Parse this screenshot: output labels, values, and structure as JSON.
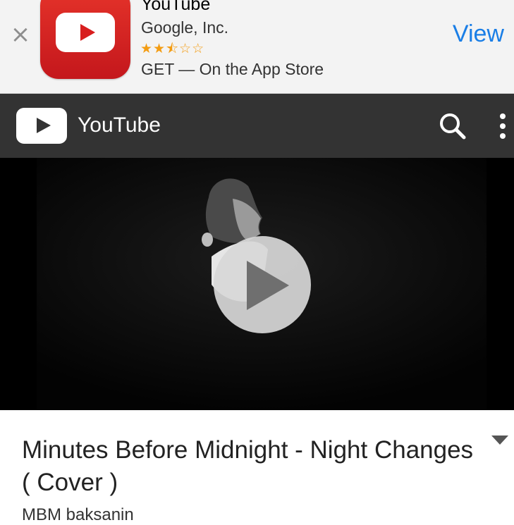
{
  "banner": {
    "close_glyph": "×",
    "app_name": "YouTube",
    "developer": "Google, Inc.",
    "rating_stars": "★★⯪☆☆",
    "rating_value": 2.5,
    "rating_max": 5,
    "get_text": "GET — On the App Store",
    "view_label": "View",
    "accent_color": "#1a7ee6",
    "icon_color": "#d81e1e"
  },
  "header": {
    "brand": "YouTube",
    "background": "#333333",
    "icons": [
      "youtube-logo-icon",
      "search-icon",
      "more-vert-icon"
    ]
  },
  "video": {
    "play_icon": "play-icon"
  },
  "info": {
    "title": "Minutes Before Midnight - Night Changes ( Cover )",
    "channel_partial": "MBM baksanin",
    "expand_icon": "chevron-down-icon"
  }
}
